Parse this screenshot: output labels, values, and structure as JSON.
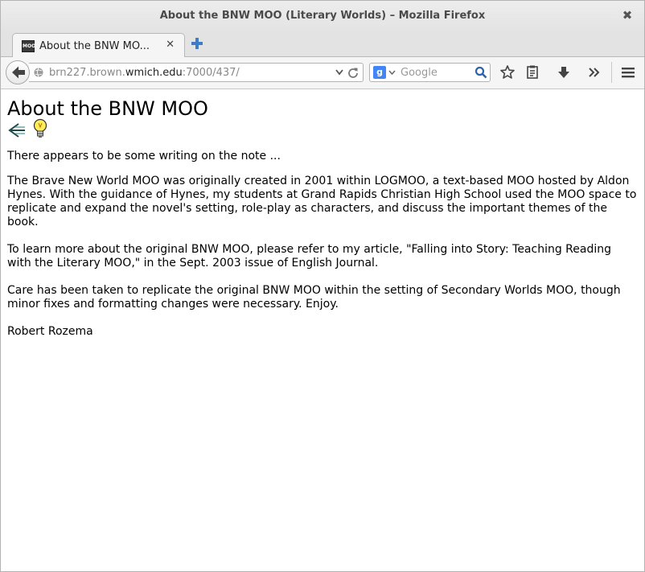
{
  "window": {
    "title": "About the BNW MOO (Literary Worlds) – Mozilla Firefox",
    "close_glyph": "✖"
  },
  "tabs": [
    {
      "label": "About the BNW MO...",
      "favicon_text": "MOO",
      "close_glyph": "✕"
    }
  ],
  "navbar": {
    "url_prefix": "brn227.brown.",
    "url_domain": "wmich.edu",
    "url_suffix": ":7000/437/",
    "search_placeholder": "Google",
    "search_engine_letter": "g"
  },
  "icons": {
    "back": "back-arrow-icon",
    "new_tab": "plus-icon",
    "bookmark": "star-icon",
    "reading_list": "clipboard-icon",
    "downloads": "download-icon",
    "overflow": "double-chevron-icon",
    "menu": "hamburger-icon"
  },
  "page": {
    "heading": "About the BNW MOO",
    "intro": "There appears to be some writing on the note ...",
    "paragraph1": "The Brave New World MOO was originally created in 2001 within LOGMOO, a text-based MOO hosted by Aldon Hynes. With the guidance of Hynes, my students at Grand Rapids Christian High School used the MOO space to replicate and expand the novel's setting, role-play as characters, and discuss the important themes of the book.",
    "paragraph2": "To learn more about the original BNW MOO, please refer to my article, \"Falling into Story: Teaching Reading with the Literary MOO,\" in the Sept. 2003 issue of English Journal.",
    "paragraph3": "Care has been taken to replicate the original BNW MOO within the setting of Secondary Worlds MOO, though minor fixes and formatting changes were necessary. Enjoy.",
    "signature": "Robert Rozema"
  },
  "colors": {
    "link_blue": "#4a90d9",
    "bulb_yellow": "#ffee55",
    "arrow_teal": "#2a6a6a"
  }
}
